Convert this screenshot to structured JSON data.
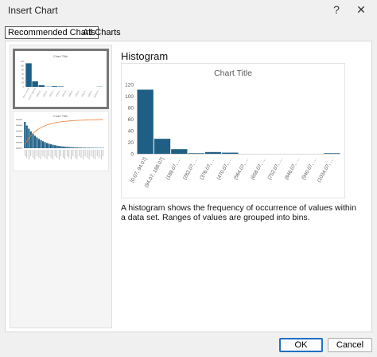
{
  "window": {
    "title": "Insert Chart",
    "help_glyph": "?",
    "close_glyph": "✕"
  },
  "tabs": [
    {
      "label": "Recommended Charts"
    },
    {
      "label": "All Charts"
    }
  ],
  "thumbnails": [
    {
      "title": "Chart Title",
      "type": "histogram"
    },
    {
      "title": "Chart Title",
      "type": "pareto"
    }
  ],
  "detail": {
    "heading": "Histogram",
    "description": "A histogram shows the frequency of occurrence of values within a data set. Ranges of values are grouped into bins."
  },
  "chart_data": {
    "type": "bar",
    "title": "Chart Title",
    "categories": [
      "[0.07, 94.07]",
      "(94.07, 188.07]",
      "(188.07, …",
      "(282.07, …",
      "(376.07, …",
      "(470.07, …",
      "(564.07, …",
      "(658.07, …",
      "(752.07, …",
      "(846.07, …",
      "(940.07, …",
      "(1034.07, …"
    ],
    "values": [
      111,
      26,
      8,
      1,
      3,
      2,
      0,
      0,
      0,
      0,
      0,
      1
    ],
    "yticks": [
      0,
      20,
      40,
      60,
      80,
      100,
      120
    ],
    "ylim": [
      0,
      120
    ],
    "color": "#1f5f85",
    "grid": false
  },
  "buttons": {
    "ok": "OK",
    "cancel": "Cancel"
  },
  "colors": {
    "bar": "#1f5f85",
    "pareto_line": "#ed7d31",
    "focus": "#1f6fc5"
  }
}
